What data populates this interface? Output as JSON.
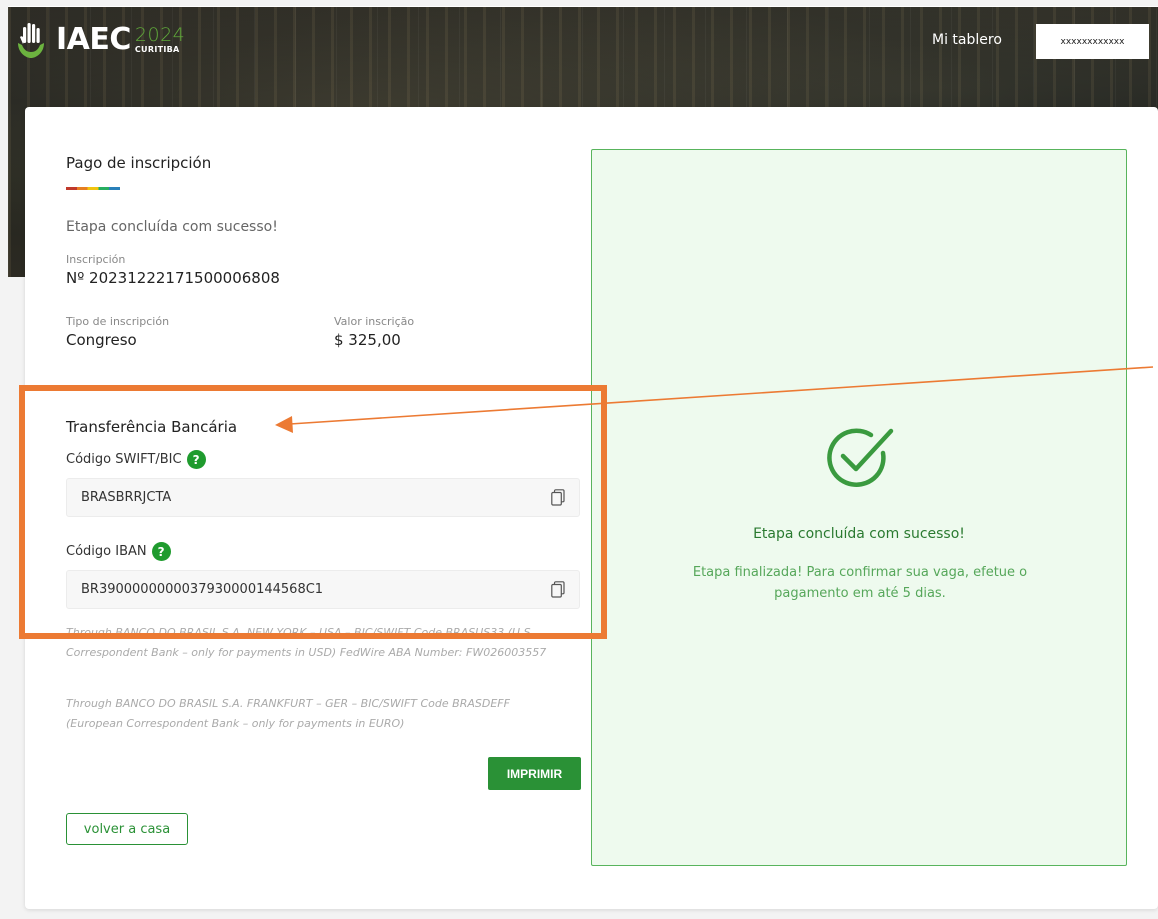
{
  "header": {
    "logo_text": "IAEC",
    "logo_year": "2024",
    "logo_city": "CURITIBA",
    "nav_link": "Mi tablero",
    "user_name": "xxxxxxxxxxxx"
  },
  "left": {
    "section_title": "Pago de inscripción",
    "status_text": "Etapa concluída com sucesso!",
    "inscription_label": "Inscripción",
    "inscription_value": "Nº 20231222171500006808",
    "type_label": "Tipo de inscripción",
    "type_value": "Congreso",
    "amount_label": "Valor inscrição",
    "amount_value": "$ 325,00",
    "bank_title": "Transferência Bancária",
    "swift_label": "Código SWIFT/BIC",
    "swift_value": "BRASBRRJCTA",
    "iban_label": "Código IBAN",
    "iban_value": "BR3900000000037930000144568C1",
    "help_glyph": "?",
    "note1": "Through BANCO DO BRASIL S.A. NEW YORK – USA – BIC/SWIFT Code BRASUS33 (U.S Correspondent Bank – only for payments in USD) FedWire ABA Number: FW026003557",
    "note2": "Through BANCO DO BRASIL S.A. FRANKFURT – GER – BIC/SWIFT Code BRASDEFF (European Correspondent Bank – only for payments in EURO)",
    "print_label": "IMPRIMIR",
    "back_label": "volver a casa"
  },
  "right": {
    "success_title": "Etapa concluída com sucesso!",
    "success_msg": "Etapa finalizada! Para confirmar sua vaga, efetue o pagamento em até 5 dias."
  },
  "colors": {
    "accent_green": "#2a9136",
    "panel_bg": "#eefaee",
    "annotation_orange": "#ec7a33"
  },
  "icons": [
    "logo-hands-icon",
    "help-icon",
    "copy-icon",
    "check-circle-icon"
  ]
}
